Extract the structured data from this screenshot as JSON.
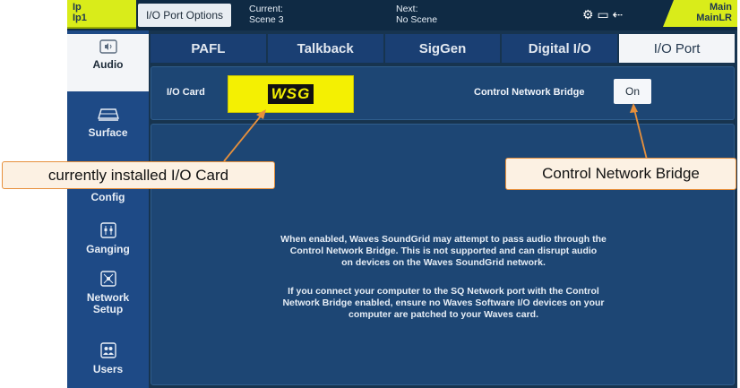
{
  "topbar": {
    "ip_line1": "Ip",
    "ip_line2": "Ip1",
    "tab_label": "I/O Port Options",
    "current_label": "Current:",
    "current_value": "Scene 3",
    "next_label": "Next:",
    "next_value": "No Scene",
    "status_icons": "⚙ ▭ ⇠",
    "main_line1": "Main",
    "main_line2": "MainLR"
  },
  "sidebar": {
    "items": [
      {
        "label": "Audio",
        "icon": "speaker-icon"
      },
      {
        "label": "Surface",
        "icon": "surface-icon"
      },
      {
        "label": "Config",
        "icon": "config-icon"
      },
      {
        "label": "Ganging",
        "icon": "ganging-icon"
      },
      {
        "label": "Network Setup",
        "icon": "network-icon"
      },
      {
        "label": "Users",
        "icon": "users-icon"
      }
    ]
  },
  "tabs": [
    "PAFL",
    "Talkback",
    "SigGen",
    "Digital I/O",
    "I/O Port"
  ],
  "active_tab": "I/O Port",
  "io": {
    "card_label": "I/O Card",
    "card_name": "WSG",
    "cnb_label": "Control Network Bridge",
    "cnb_value": "On"
  },
  "warning": {
    "lines1": [
      "When enabled, Waves SoundGrid may attempt to pass audio through the",
      "Control Network Bridge. This is not supported and can disrupt audio",
      "on devices on the Waves SoundGrid network."
    ],
    "lines2": [
      "If you connect your computer to the SQ Network port with the Control",
      "Network Bridge enabled, ensure no Waves Software I/O devices on your",
      "computer are patched to your Waves card."
    ]
  },
  "annotations": {
    "io_card": "currently installed I/O Card",
    "cnb": "Control Network Bridge",
    "accent_color": "#e7903c"
  }
}
